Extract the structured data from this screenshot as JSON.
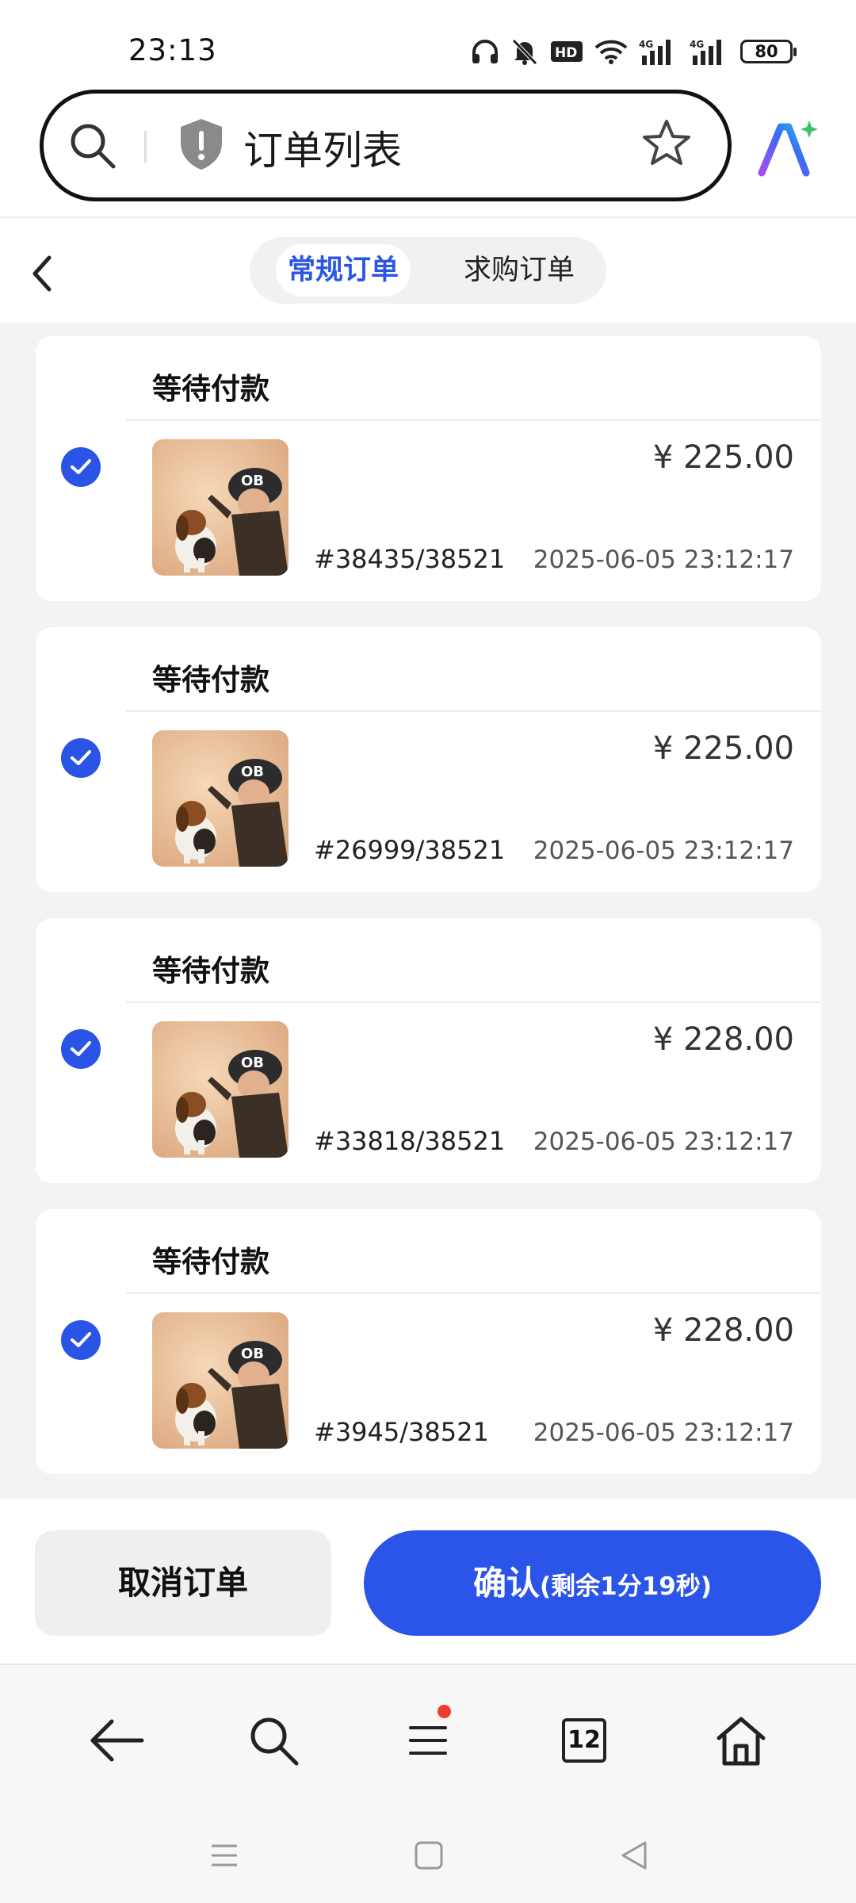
{
  "status_bar": {
    "time": "23:13",
    "battery": "80"
  },
  "address_bar": {
    "title": "订单列表"
  },
  "tabs": {
    "regular": "常规订单",
    "purchase": "求购订单"
  },
  "orders": [
    {
      "status": "等待付款",
      "price": "¥ 225.00",
      "order_id": "#38435/38521",
      "date": "2025-06-05 23:12:17"
    },
    {
      "status": "等待付款",
      "price": "¥ 225.00",
      "order_id": "#26999/38521",
      "date": "2025-06-05 23:12:17"
    },
    {
      "status": "等待付款",
      "price": "¥ 228.00",
      "order_id": "#33818/38521",
      "date": "2025-06-05 23:12:17"
    },
    {
      "status": "等待付款",
      "price": "¥ 228.00",
      "order_id": "#3945/38521",
      "date": "2025-06-05 23:12:17"
    }
  ],
  "actions": {
    "cancel": "取消订单",
    "confirm": "确认",
    "countdown": "(剩余1分19秒)"
  },
  "toolbar": {
    "tab_count": "12"
  },
  "colors": {
    "accent": "#2b54e9",
    "selected_tab": "#2a56e6",
    "notification_dot": "#f03c2e"
  }
}
